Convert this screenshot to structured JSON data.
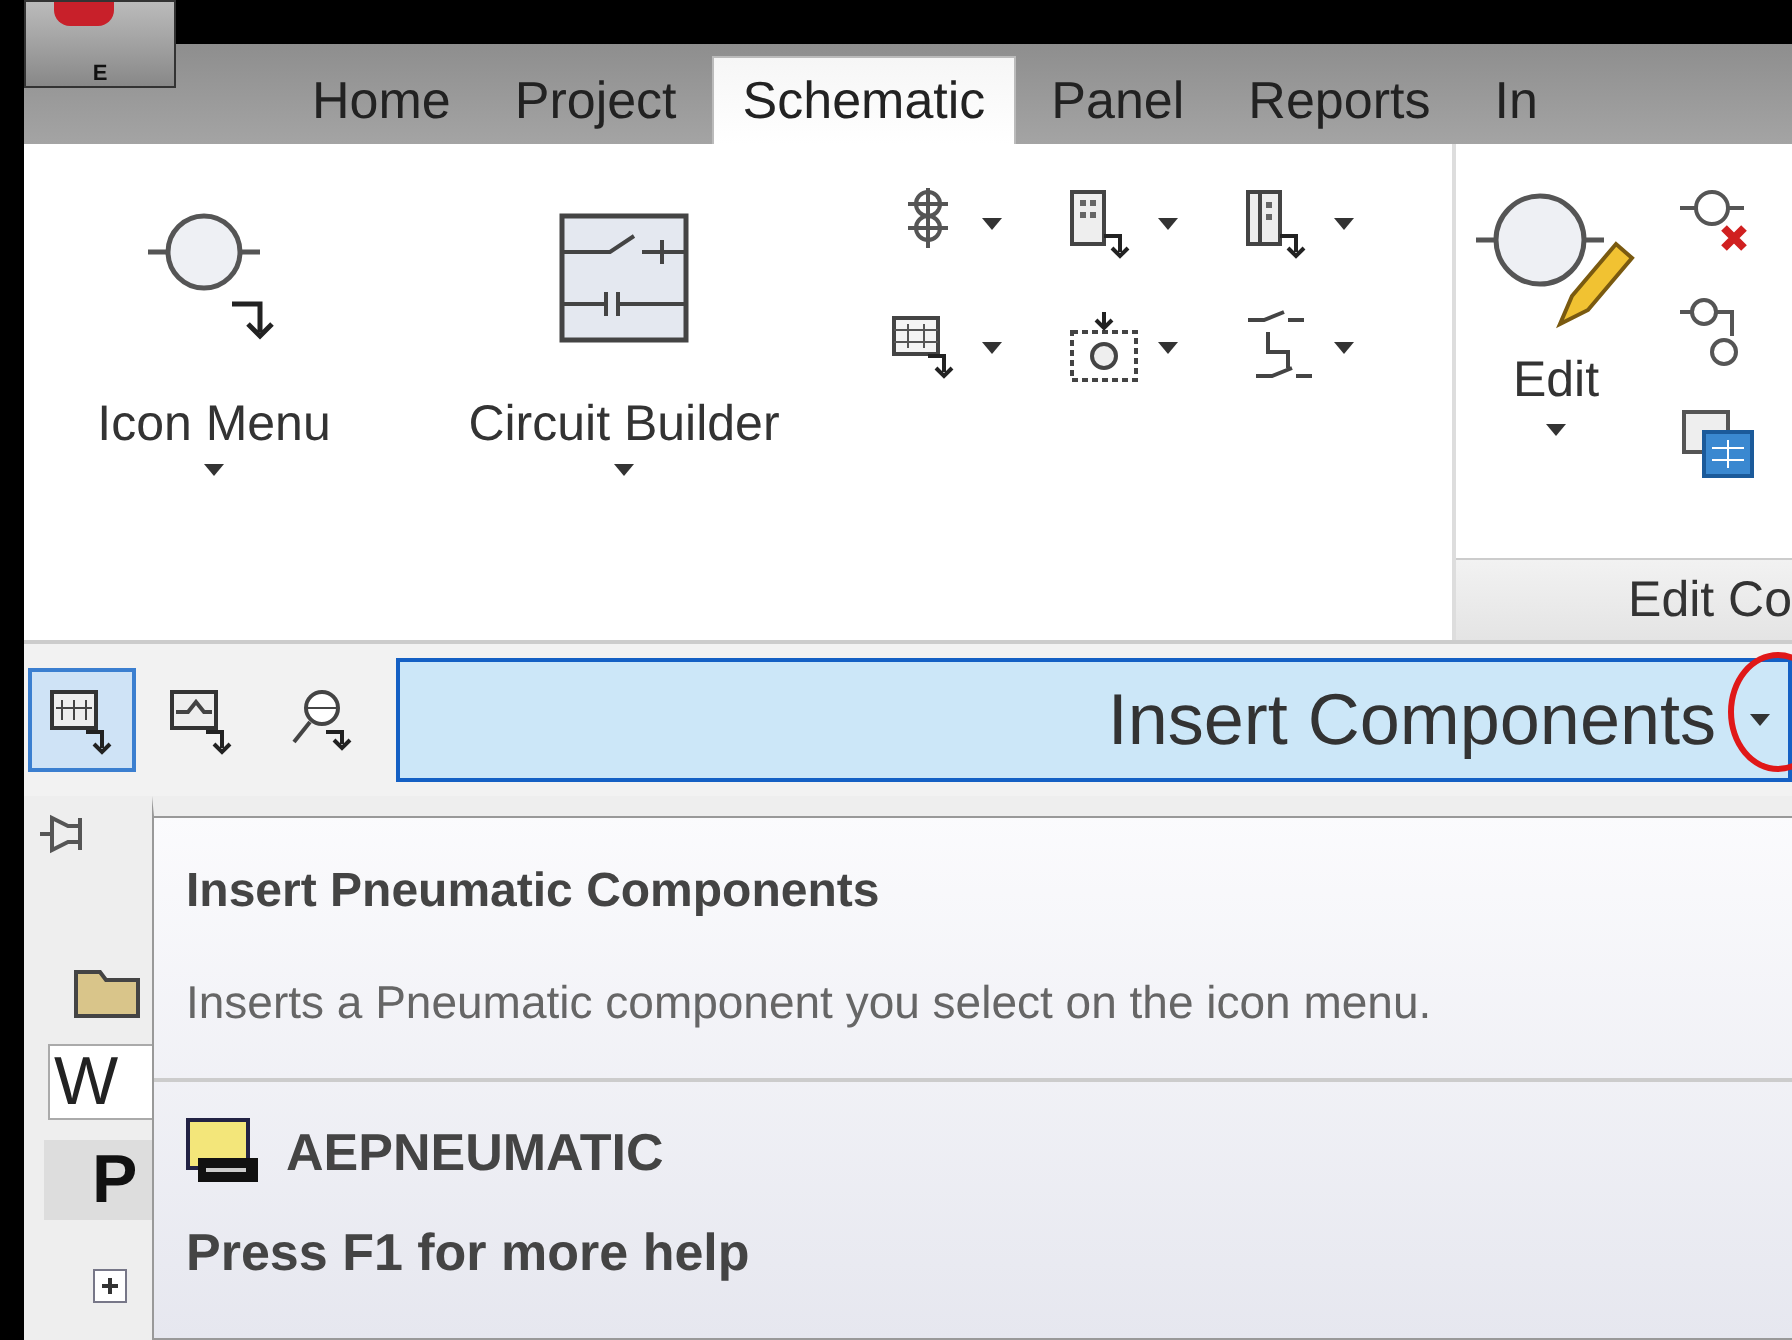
{
  "app_button": {
    "label": "E"
  },
  "tabs": [
    {
      "label": "Home",
      "selected": false
    },
    {
      "label": "Project",
      "selected": false
    },
    {
      "label": "Schematic",
      "selected": true
    },
    {
      "label": "Panel",
      "selected": false
    },
    {
      "label": "Reports",
      "selected": false
    },
    {
      "label": "In",
      "selected": false
    }
  ],
  "ribbon": {
    "large_buttons": [
      {
        "label": "Icon Menu",
        "kind": "icon-menu"
      },
      {
        "label": "Circuit Builder",
        "kind": "circuit"
      }
    ],
    "small_tools": [
      {
        "kind": "terminal"
      },
      {
        "kind": "rack"
      },
      {
        "kind": "strip"
      },
      {
        "kind": "ladder"
      },
      {
        "kind": "dashed"
      },
      {
        "kind": "switch"
      }
    ],
    "edit_panel": {
      "button": "Edit",
      "panel_title": "Edit Co",
      "tools": [
        {
          "kind": "delete"
        },
        {
          "kind": "copy"
        },
        {
          "kind": "swap"
        }
      ]
    }
  },
  "palette": {
    "tools": [
      {
        "kind": "insert",
        "selected": true
      },
      {
        "kind": "insert2",
        "selected": false
      },
      {
        "kind": "search",
        "selected": false
      }
    ],
    "title": "Insert Components"
  },
  "side_panel": {
    "field_value": "W",
    "header": "P"
  },
  "tooltip": {
    "title": "Insert Pneumatic Components",
    "description": "Inserts a Pneumatic component you select on the icon menu.",
    "command": "AEPNEUMATIC",
    "help": "Press F1 for more help"
  }
}
